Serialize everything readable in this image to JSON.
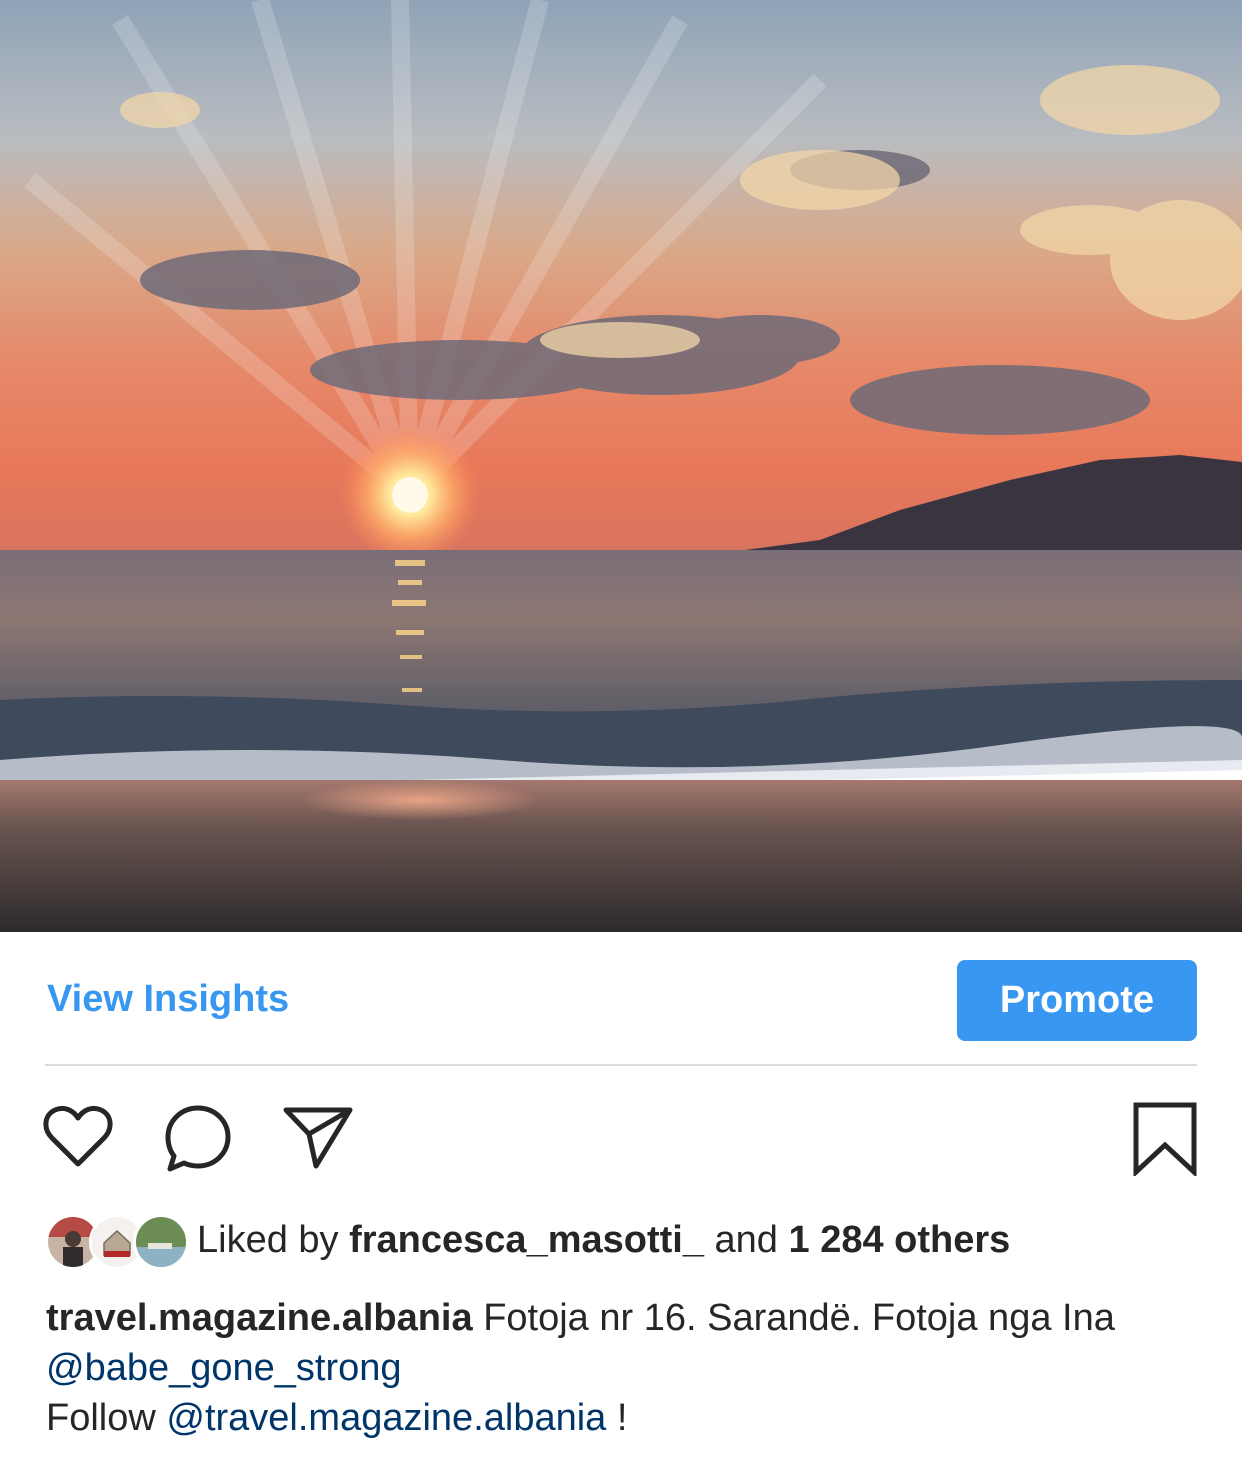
{
  "post": {
    "image_alt": "Sunset over the sea at a pebble beach with a hill on the right"
  },
  "insights": {
    "view_label": "View Insights",
    "promote_label": "Promote"
  },
  "actions": {
    "like_icon": "heart-icon",
    "comment_icon": "comment-icon",
    "share_icon": "paper-plane-icon",
    "save_icon": "bookmark-icon"
  },
  "likes": {
    "prefix": "Liked by",
    "user": "francesca_masotti_",
    "and": "and",
    "count": "1 284 others"
  },
  "caption": {
    "username": "travel.magazine.albania",
    "text_part1": "Fotoja nr 16. Sarandë. Fotoja nga Ina",
    "mention1": "@babe_gone_strong",
    "follow_prefix": "Follow",
    "mention2": "@travel.magazine.albania",
    "follow_suffix": "!"
  },
  "colors": {
    "accent": "#3897f0",
    "mention": "#003569",
    "text": "#262626",
    "divider": "#dbdbdb"
  }
}
